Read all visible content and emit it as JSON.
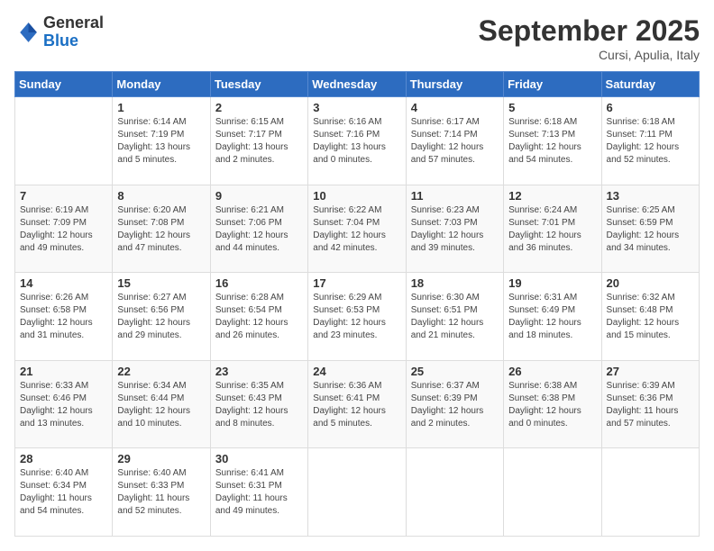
{
  "header": {
    "logo_general": "General",
    "logo_blue": "Blue",
    "month_title": "September 2025",
    "location": "Cursi, Apulia, Italy"
  },
  "days_of_week": [
    "Sunday",
    "Monday",
    "Tuesday",
    "Wednesday",
    "Thursday",
    "Friday",
    "Saturday"
  ],
  "weeks": [
    [
      {
        "day": "",
        "sunrise": "",
        "sunset": "",
        "daylight": ""
      },
      {
        "day": "1",
        "sunrise": "Sunrise: 6:14 AM",
        "sunset": "Sunset: 7:19 PM",
        "daylight": "Daylight: 13 hours and 5 minutes."
      },
      {
        "day": "2",
        "sunrise": "Sunrise: 6:15 AM",
        "sunset": "Sunset: 7:17 PM",
        "daylight": "Daylight: 13 hours and 2 minutes."
      },
      {
        "day": "3",
        "sunrise": "Sunrise: 6:16 AM",
        "sunset": "Sunset: 7:16 PM",
        "daylight": "Daylight: 13 hours and 0 minutes."
      },
      {
        "day": "4",
        "sunrise": "Sunrise: 6:17 AM",
        "sunset": "Sunset: 7:14 PM",
        "daylight": "Daylight: 12 hours and 57 minutes."
      },
      {
        "day": "5",
        "sunrise": "Sunrise: 6:18 AM",
        "sunset": "Sunset: 7:13 PM",
        "daylight": "Daylight: 12 hours and 54 minutes."
      },
      {
        "day": "6",
        "sunrise": "Sunrise: 6:18 AM",
        "sunset": "Sunset: 7:11 PM",
        "daylight": "Daylight: 12 hours and 52 minutes."
      }
    ],
    [
      {
        "day": "7",
        "sunrise": "Sunrise: 6:19 AM",
        "sunset": "Sunset: 7:09 PM",
        "daylight": "Daylight: 12 hours and 49 minutes."
      },
      {
        "day": "8",
        "sunrise": "Sunrise: 6:20 AM",
        "sunset": "Sunset: 7:08 PM",
        "daylight": "Daylight: 12 hours and 47 minutes."
      },
      {
        "day": "9",
        "sunrise": "Sunrise: 6:21 AM",
        "sunset": "Sunset: 7:06 PM",
        "daylight": "Daylight: 12 hours and 44 minutes."
      },
      {
        "day": "10",
        "sunrise": "Sunrise: 6:22 AM",
        "sunset": "Sunset: 7:04 PM",
        "daylight": "Daylight: 12 hours and 42 minutes."
      },
      {
        "day": "11",
        "sunrise": "Sunrise: 6:23 AM",
        "sunset": "Sunset: 7:03 PM",
        "daylight": "Daylight: 12 hours and 39 minutes."
      },
      {
        "day": "12",
        "sunrise": "Sunrise: 6:24 AM",
        "sunset": "Sunset: 7:01 PM",
        "daylight": "Daylight: 12 hours and 36 minutes."
      },
      {
        "day": "13",
        "sunrise": "Sunrise: 6:25 AM",
        "sunset": "Sunset: 6:59 PM",
        "daylight": "Daylight: 12 hours and 34 minutes."
      }
    ],
    [
      {
        "day": "14",
        "sunrise": "Sunrise: 6:26 AM",
        "sunset": "Sunset: 6:58 PM",
        "daylight": "Daylight: 12 hours and 31 minutes."
      },
      {
        "day": "15",
        "sunrise": "Sunrise: 6:27 AM",
        "sunset": "Sunset: 6:56 PM",
        "daylight": "Daylight: 12 hours and 29 minutes."
      },
      {
        "day": "16",
        "sunrise": "Sunrise: 6:28 AM",
        "sunset": "Sunset: 6:54 PM",
        "daylight": "Daylight: 12 hours and 26 minutes."
      },
      {
        "day": "17",
        "sunrise": "Sunrise: 6:29 AM",
        "sunset": "Sunset: 6:53 PM",
        "daylight": "Daylight: 12 hours and 23 minutes."
      },
      {
        "day": "18",
        "sunrise": "Sunrise: 6:30 AM",
        "sunset": "Sunset: 6:51 PM",
        "daylight": "Daylight: 12 hours and 21 minutes."
      },
      {
        "day": "19",
        "sunrise": "Sunrise: 6:31 AM",
        "sunset": "Sunset: 6:49 PM",
        "daylight": "Daylight: 12 hours and 18 minutes."
      },
      {
        "day": "20",
        "sunrise": "Sunrise: 6:32 AM",
        "sunset": "Sunset: 6:48 PM",
        "daylight": "Daylight: 12 hours and 15 minutes."
      }
    ],
    [
      {
        "day": "21",
        "sunrise": "Sunrise: 6:33 AM",
        "sunset": "Sunset: 6:46 PM",
        "daylight": "Daylight: 12 hours and 13 minutes."
      },
      {
        "day": "22",
        "sunrise": "Sunrise: 6:34 AM",
        "sunset": "Sunset: 6:44 PM",
        "daylight": "Daylight: 12 hours and 10 minutes."
      },
      {
        "day": "23",
        "sunrise": "Sunrise: 6:35 AM",
        "sunset": "Sunset: 6:43 PM",
        "daylight": "Daylight: 12 hours and 8 minutes."
      },
      {
        "day": "24",
        "sunrise": "Sunrise: 6:36 AM",
        "sunset": "Sunset: 6:41 PM",
        "daylight": "Daylight: 12 hours and 5 minutes."
      },
      {
        "day": "25",
        "sunrise": "Sunrise: 6:37 AM",
        "sunset": "Sunset: 6:39 PM",
        "daylight": "Daylight: 12 hours and 2 minutes."
      },
      {
        "day": "26",
        "sunrise": "Sunrise: 6:38 AM",
        "sunset": "Sunset: 6:38 PM",
        "daylight": "Daylight: 12 hours and 0 minutes."
      },
      {
        "day": "27",
        "sunrise": "Sunrise: 6:39 AM",
        "sunset": "Sunset: 6:36 PM",
        "daylight": "Daylight: 11 hours and 57 minutes."
      }
    ],
    [
      {
        "day": "28",
        "sunrise": "Sunrise: 6:40 AM",
        "sunset": "Sunset: 6:34 PM",
        "daylight": "Daylight: 11 hours and 54 minutes."
      },
      {
        "day": "29",
        "sunrise": "Sunrise: 6:40 AM",
        "sunset": "Sunset: 6:33 PM",
        "daylight": "Daylight: 11 hours and 52 minutes."
      },
      {
        "day": "30",
        "sunrise": "Sunrise: 6:41 AM",
        "sunset": "Sunset: 6:31 PM",
        "daylight": "Daylight: 11 hours and 49 minutes."
      },
      {
        "day": "",
        "sunrise": "",
        "sunset": "",
        "daylight": ""
      },
      {
        "day": "",
        "sunrise": "",
        "sunset": "",
        "daylight": ""
      },
      {
        "day": "",
        "sunrise": "",
        "sunset": "",
        "daylight": ""
      },
      {
        "day": "",
        "sunrise": "",
        "sunset": "",
        "daylight": ""
      }
    ]
  ]
}
